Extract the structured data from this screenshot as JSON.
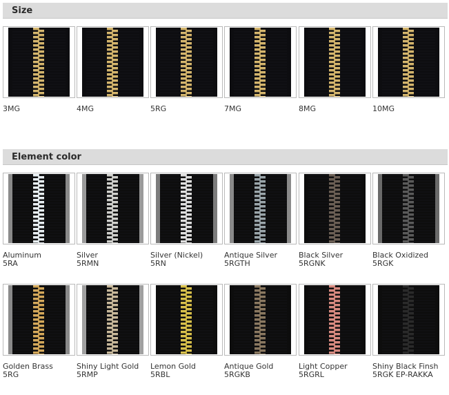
{
  "sections": [
    {
      "title": "Size",
      "items": [
        {
          "label": "3MG",
          "teeth": "#d4b56c",
          "tape": "#0d0d10",
          "stripe": "#0d0d10"
        },
        {
          "label": "4MG",
          "teeth": "#d4b56c",
          "tape": "#0d0d10",
          "stripe": "#0d0d10"
        },
        {
          "label": "5RG",
          "teeth": "#d4b56c",
          "tape": "#0d0d10",
          "stripe": "#0d0d10"
        },
        {
          "label": "7MG",
          "teeth": "#d4b56c",
          "tape": "#0d0d10",
          "stripe": "#0d0d10"
        },
        {
          "label": "8MG",
          "teeth": "#d4b56c",
          "tape": "#0d0d10",
          "stripe": "#0d0d10"
        },
        {
          "label": "10MG",
          "teeth": "#d4b56c",
          "tape": "#0d0d10",
          "stripe": "#0d0d10"
        }
      ]
    },
    {
      "title": "Element color",
      "rows": [
        [
          {
            "label": "Aluminum",
            "code": "5RA",
            "teeth": "#e8eef2",
            "tape": "#0d0d0d",
            "stripe": "#8a8a8a"
          },
          {
            "label": "Silver",
            "code": "5RMN",
            "teeth": "#d0d0cc",
            "tape": "#0d0d0d",
            "stripe": "#9a9a9a"
          },
          {
            "label": "Silver (Nickel)",
            "code": "5RN",
            "teeth": "#dedede",
            "tape": "#0d0d0d",
            "stripe": "#7c7c7c"
          },
          {
            "label": "Antique Silver",
            "code": "5RGTH",
            "teeth": "#9aa5aa",
            "tape": "#0d0d0d",
            "stripe": "#8a8a8a"
          },
          {
            "label": "Black Silver",
            "code": "5RGNK",
            "teeth": "#6b5f55",
            "tape": "#0d0d0d",
            "stripe": "#0d0d0d"
          },
          {
            "label": "Black Oxidized",
            "code": "5RGK",
            "teeth": "#5a5a5a",
            "tape": "#0d0d0d",
            "stripe": "#6a6a6a"
          }
        ],
        [
          {
            "label": "Golden Brass",
            "code": "5RG",
            "teeth": "#d4a85a",
            "tape": "#0d0d0d",
            "stripe": "#8a8a8a"
          },
          {
            "label": "Shiny Light Gold",
            "code": "5RMP",
            "teeth": "#c8b89a",
            "tape": "#0d0d0d",
            "stripe": "#a0a0a0"
          },
          {
            "label": "Lemon Gold",
            "code": "5RBL",
            "teeth": "#d8c04a",
            "tape": "#0d0d0d",
            "stripe": "#0d0d0d"
          },
          {
            "label": "Antique Gold",
            "code": "5RGKB",
            "teeth": "#8a7860",
            "tape": "#0d0d0d",
            "stripe": "#0d0d0d"
          },
          {
            "label": "Light Copper",
            "code": "5RGRL",
            "teeth": "#d88a80",
            "tape": "#0d0d0d",
            "stripe": "#0d0d0d"
          },
          {
            "label": "Shiny Black Finsh",
            "code": "5RGK EP-RAKKA",
            "teeth": "#2a2a2a",
            "tape": "#0d0d0d",
            "stripe": "#0d0d0d"
          }
        ]
      ]
    }
  ]
}
